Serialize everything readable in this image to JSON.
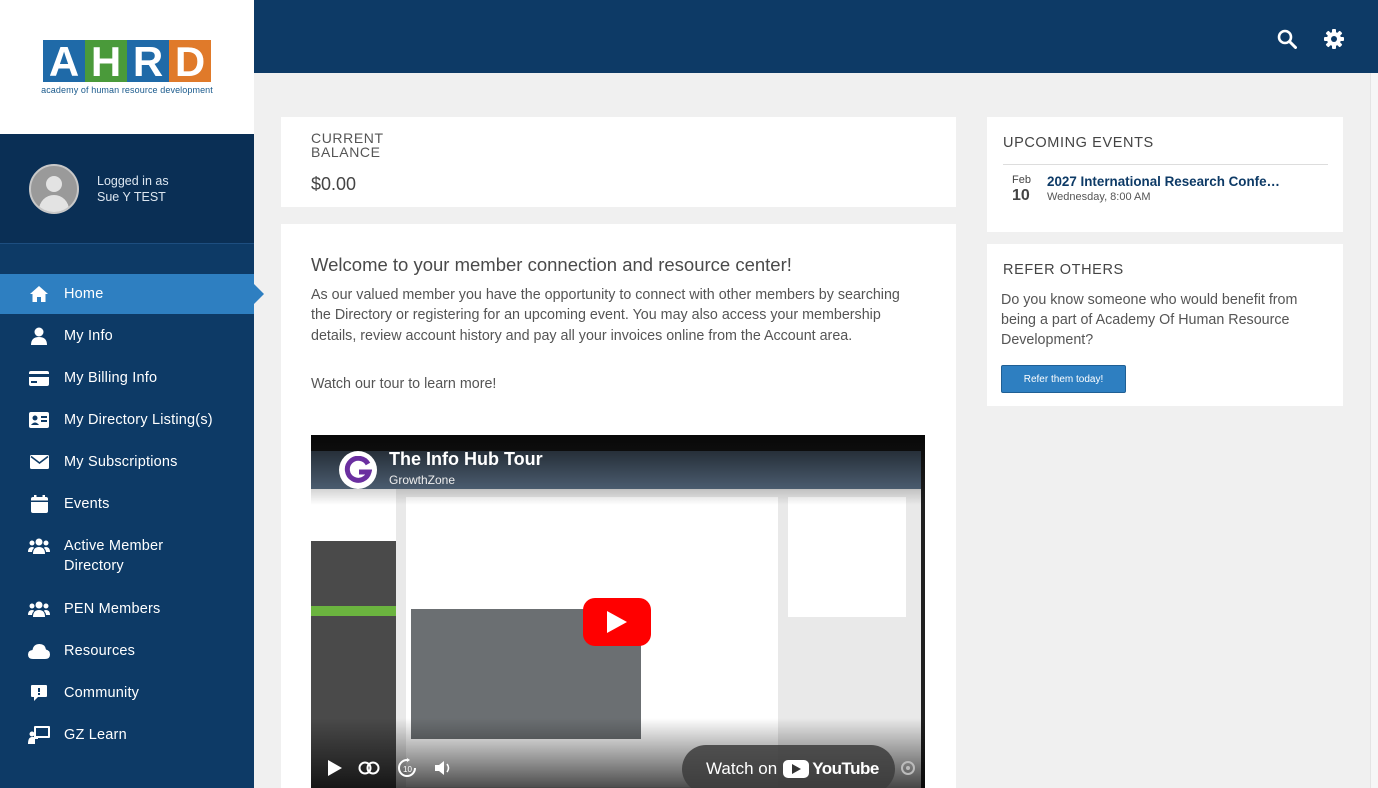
{
  "logo": {
    "letters": [
      "A",
      "H",
      "R",
      "D"
    ],
    "tagline": "academy of human resource development",
    "colors": {
      "blue": "#1f6aa8",
      "green": "#4a9a3a",
      "orange": "#e07a2a"
    }
  },
  "user": {
    "logged_in_label": "Logged in as",
    "name": "Sue Y TEST"
  },
  "nav": {
    "items": [
      {
        "label": "Home",
        "icon": "home-icon",
        "active": true
      },
      {
        "label": "My Info",
        "icon": "user-icon"
      },
      {
        "label": "My Billing Info",
        "icon": "credit-card-icon"
      },
      {
        "label": "My Directory Listing(s)",
        "icon": "id-card-icon"
      },
      {
        "label": "My Subscriptions",
        "icon": "envelope-icon"
      },
      {
        "label": "Events",
        "icon": "calendar-icon"
      },
      {
        "label": "Active Member Directory",
        "icon": "users-icon"
      },
      {
        "label": "PEN Members",
        "icon": "users-icon"
      },
      {
        "label": "Resources",
        "icon": "cloud-icon"
      },
      {
        "label": "Community",
        "icon": "chat-icon"
      },
      {
        "label": "GZ Learn",
        "icon": "presentation-icon"
      }
    ]
  },
  "topbar": {
    "icons": [
      "search-icon",
      "gear-icon"
    ]
  },
  "balance": {
    "label": "CURRENT BALANCE",
    "value": "$0.00"
  },
  "welcome": {
    "title": "Welcome to your member connection and resource center!",
    "body": "As our valued member you have the opportunity to connect with other members by searching the Directory or registering for an upcoming event. You may also access your membership details, review account history and pay all your invoices online from the Account area.",
    "tour_text": "Watch our tour to learn more!"
  },
  "video": {
    "title": "The Info Hub Tour",
    "channel": "GrowthZone",
    "watch_on": "Watch on",
    "youtube": "YouTube"
  },
  "events": {
    "title": "UPCOMING EVENTS",
    "items": [
      {
        "month": "Feb",
        "day": "10",
        "title": "2027 International Research Confe…",
        "time": "Wednesday, 8:00 AM"
      }
    ]
  },
  "refer": {
    "title": "REFER OTHERS",
    "text": "Do you know someone who would benefit from being a part of Academy Of Human Resource Development?",
    "button": "Refer them today!"
  },
  "colors": {
    "navy": "#0d3a66",
    "accent": "#2e7fc1",
    "youtube_red": "#ff0000"
  }
}
